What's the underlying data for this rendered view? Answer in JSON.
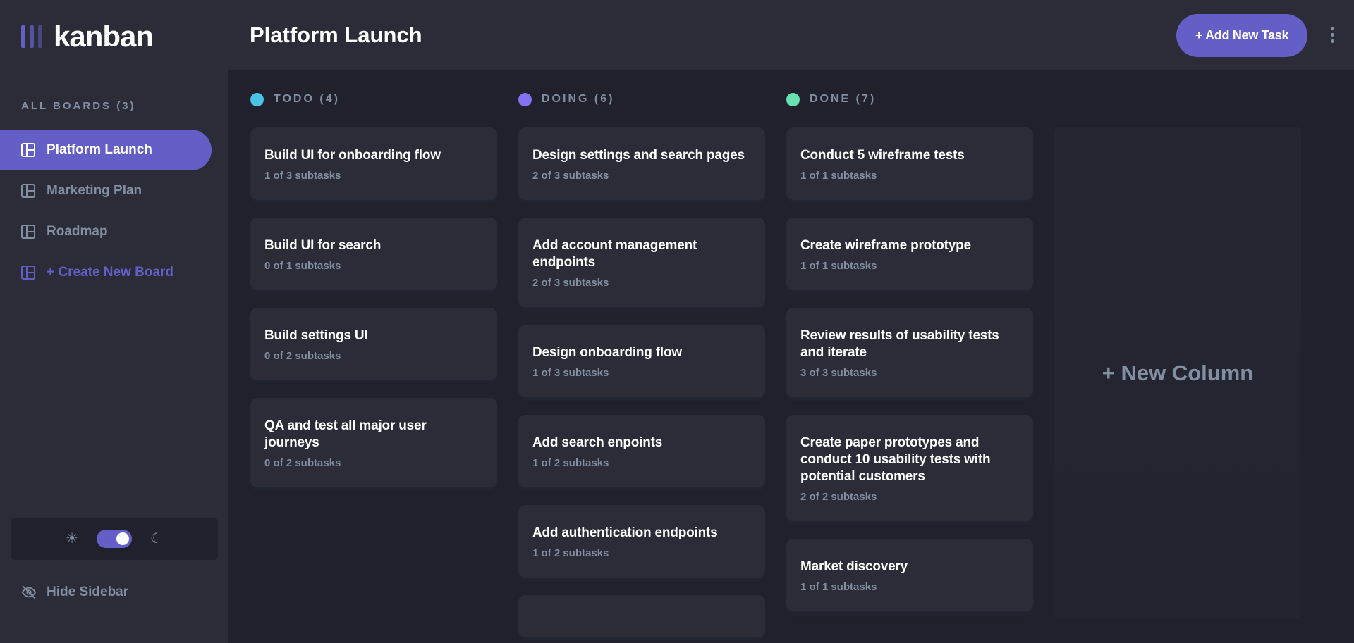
{
  "sidebar": {
    "logo_text": "kanban",
    "boards_heading": "ALL BOARDS (3)",
    "boards": [
      {
        "label": "Platform Launch",
        "active": true
      },
      {
        "label": "Marketing Plan",
        "active": false
      },
      {
        "label": "Roadmap",
        "active": false
      }
    ],
    "create_board_label": "+ Create New Board",
    "theme": {
      "light_icon": "sun-icon",
      "dark_icon": "moon-icon",
      "mode": "dark"
    },
    "hide_sidebar_label": "Hide Sidebar"
  },
  "header": {
    "title": "Platform Launch",
    "add_task_label": "+ Add New Task",
    "menu_icon": "vertical-dots-icon"
  },
  "columns": [
    {
      "name": "TODO (4)",
      "color": "#49c4e5",
      "tasks": [
        {
          "title": "Build UI for onboarding flow",
          "subtasks": "1 of 3 subtasks"
        },
        {
          "title": "Build UI for search",
          "subtasks": "0 of 1 subtasks"
        },
        {
          "title": "Build settings UI",
          "subtasks": "0 of 2 subtasks"
        },
        {
          "title": "QA and test all major user journeys",
          "subtasks": "0 of 2 subtasks"
        }
      ]
    },
    {
      "name": "DOING (6)",
      "color": "#8471f2",
      "tasks": [
        {
          "title": "Design settings and search pages",
          "subtasks": "2 of 3 subtasks"
        },
        {
          "title": "Add account management endpoints",
          "subtasks": "2 of 3 subtasks"
        },
        {
          "title": "Design onboarding flow",
          "subtasks": "1 of 3 subtasks"
        },
        {
          "title": "Add search enpoints",
          "subtasks": "1 of 2 subtasks"
        },
        {
          "title": "Add authentication endpoints",
          "subtasks": "1 of 2 subtasks"
        }
      ]
    },
    {
      "name": "DONE (7)",
      "color": "#67e2ae",
      "tasks": [
        {
          "title": "Conduct 5 wireframe tests",
          "subtasks": "1 of 1 subtasks"
        },
        {
          "title": "Create wireframe prototype",
          "subtasks": "1 of 1 subtasks"
        },
        {
          "title": "Review results of usability tests and iterate",
          "subtasks": "3 of 3 subtasks"
        },
        {
          "title": "Create paper prototypes and conduct 10 usability tests with potential customers",
          "subtasks": "2 of 2 subtasks"
        },
        {
          "title": "Market discovery",
          "subtasks": "1 of 1 subtasks"
        }
      ]
    }
  ],
  "new_column_label": "+ New Column",
  "colors": {
    "accent": "#635fc7",
    "bg": "#20212c",
    "panel": "#2b2c37",
    "muted": "#828fa3"
  }
}
